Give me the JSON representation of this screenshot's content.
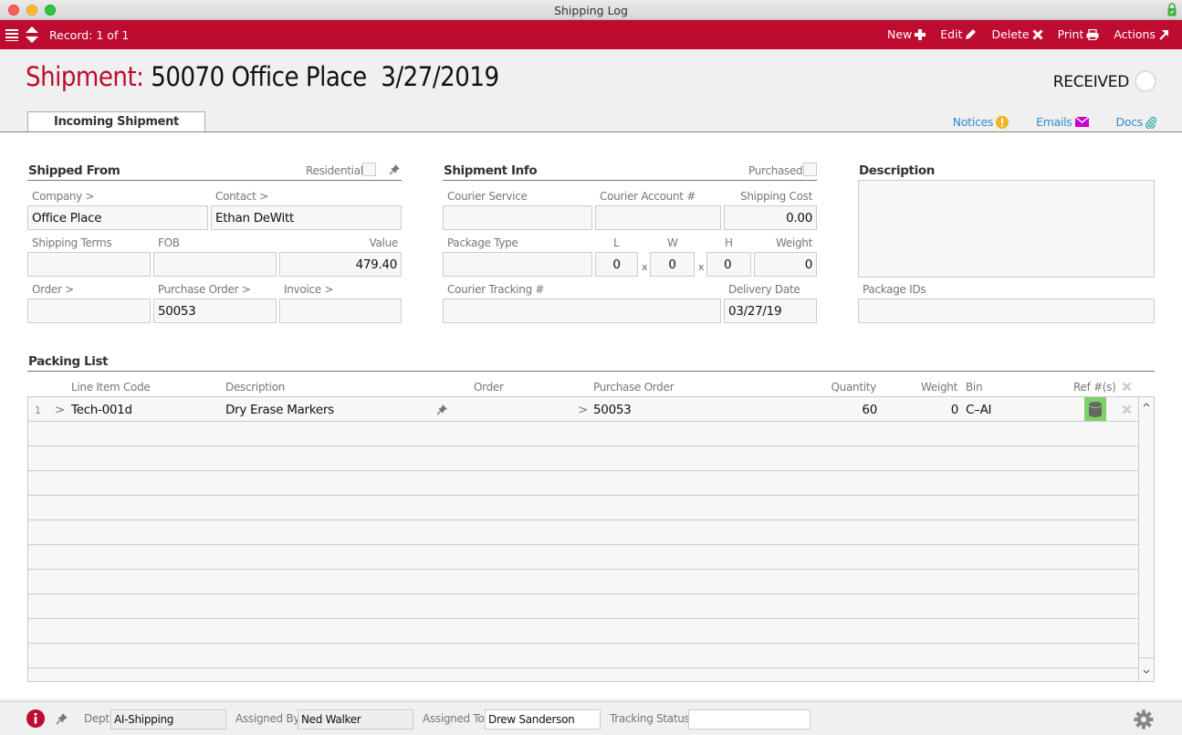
{
  "window": {
    "title": "Shipping Log"
  },
  "toolbar": {
    "record_label": "Record: 1 of 1",
    "buttons": [
      {
        "label": "New",
        "icon": "plus-icon"
      },
      {
        "label": "Edit",
        "icon": "pencil-icon"
      },
      {
        "label": "Delete",
        "icon": "x-icon"
      },
      {
        "label": "Print",
        "icon": "printer-icon"
      },
      {
        "label": "Actions",
        "icon": "arrow-up-right-icon"
      }
    ]
  },
  "header": {
    "prefix": "Shipment:",
    "title": "50070 Office Place  3/27/2019",
    "status": "RECEIVED"
  },
  "tabs": [
    {
      "label": "Incoming Shipment"
    }
  ],
  "links": {
    "notices": "Notices",
    "emails": "Emails",
    "docs": "Docs"
  },
  "shipped_from": {
    "title": "Shipped From",
    "residential_label": "Residential",
    "residential_checked": false,
    "company_label": "Company >",
    "company": "Office Place",
    "contact_label": "Contact >",
    "contact": "Ethan DeWitt",
    "shipping_terms_label": "Shipping Terms",
    "shipping_terms": "",
    "fob_label": "FOB",
    "fob": "",
    "value_label": "Value",
    "value": "479.40",
    "order_label": "Order >",
    "order": "",
    "purchase_order_label": "Purchase Order >",
    "purchase_order": "50053",
    "invoice_label": "Invoice >",
    "invoice": ""
  },
  "shipment_info": {
    "title": "Shipment Info",
    "purchased_label": "Purchased",
    "purchased_checked": false,
    "courier_service_label": "Courier Service",
    "courier_service": "",
    "courier_account_label": "Courier Account #",
    "courier_account": "",
    "shipping_cost_label": "Shipping Cost",
    "shipping_cost": "0.00",
    "package_type_label": "Package Type",
    "package_type": "",
    "l_label": "L",
    "l": "0",
    "w_label": "W",
    "w": "0",
    "h_label": "H",
    "h": "0",
    "times": "x",
    "weight_label": "Weight",
    "weight": "0",
    "tracking_label": "Courier Tracking #",
    "tracking": "",
    "delivery_date_label": "Delivery Date",
    "delivery_date": "03/27/19"
  },
  "description": {
    "title": "Description",
    "value": "",
    "package_ids_label": "Package IDs",
    "package_ids": ""
  },
  "packing_list": {
    "title": "Packing List",
    "columns": {
      "line_item_code": "Line Item Code",
      "description": "Description",
      "order": "Order",
      "purchase_order": "Purchase Order",
      "quantity": "Quantity",
      "weight": "Weight",
      "bin": "Bin",
      "ref": "Ref #(s)"
    },
    "rows": [
      {
        "num": "1",
        "arrow": ">",
        "line_item_code": "Tech-001d",
        "description": "Dry Erase Markers",
        "order": "",
        "po_arrow": ">",
        "purchase_order": "50053",
        "quantity": "60",
        "weight": "0",
        "bin": "C–AI"
      }
    ]
  },
  "footer": {
    "dept_label": "Dept",
    "dept": "AI-Shipping",
    "assigned_by_label": "Assigned By",
    "assigned_by": "Ned Walker",
    "assigned_to_label": "Assigned To",
    "assigned_to": "Drew Sanderson",
    "tracking_status_label": "Tracking Status",
    "tracking_status": ""
  },
  "colors": {
    "brand": "#bd0c2f",
    "link": "#2e8ccd",
    "notice": "#f5b31b",
    "email": "#cc00cc",
    "docs": "#3ab0a8",
    "ref_button": "#7fd066"
  }
}
